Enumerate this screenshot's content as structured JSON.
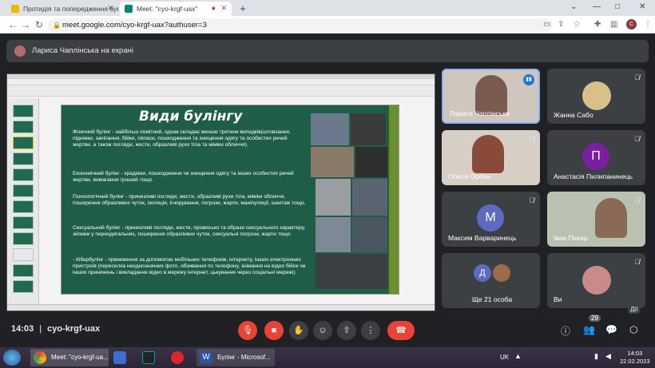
{
  "browser": {
    "tabs": [
      {
        "title": "Протидія та попередження був",
        "active": false
      },
      {
        "title": "Meet: \"cyo-krgf-uax\"",
        "active": true
      }
    ],
    "url": "meet.google.com/cyo-krgf-uax?authuser=3",
    "profile_initial": "C"
  },
  "meet": {
    "presenter_banner": "Лариса Чаплінська на екрані",
    "time": "14:03",
    "meeting_code": "cyo-krgf-uax",
    "participant_count": "29",
    "tiles": [
      {
        "name": "Лариса Чаплінська",
        "type": "video"
      },
      {
        "name": "Жанна Сабо",
        "type": "photo"
      },
      {
        "name": "Олеся Орбан",
        "type": "video"
      },
      {
        "name": "Анастасія Пилипанинець",
        "type": "initial",
        "initial": "П",
        "color": "#7b1fa2"
      },
      {
        "name": "Максим Варваринець",
        "type": "initial",
        "initial": "М",
        "color": "#5c6bc0"
      },
      {
        "name": "Іван Пекар",
        "type": "video"
      },
      {
        "name": "Ще 21 особа",
        "type": "more",
        "initial": "Д",
        "color": "#5c6bc0"
      },
      {
        "name": "Ви",
        "type": "photo"
      }
    ],
    "hover_label": "Дії"
  },
  "slide": {
    "title": "Види булінгу",
    "paragraphs": [
      "Фізичний булінг - найбільш помітний, однак складає менше третини випадків(штовхання, підніжки, зачіпання, бійки, ляпаси, пошкодження та знищення одягу та особистих речей жертви, а також погляди, жести, образливі рухи тіла та міміки обличчя).",
      "Економічний булінг - крадіжки, пошкодження чи знищення одягу та інших особистих речей жертви, вимагання грошей тощо.",
      "Психологічний булінг - принизливі погляди, жести, образливі рухи тіла, міміки обличчя, поширення образливих чуток, ізоляція, ігнорування, погрози, жарти, маніпуляції, шантаж тощо.",
      "Сексуальний булінг - принизливі погляди, жести, прізвисько та образи сексуального характеру, зйомки у переодягальнях, поширення образливих чуток, сексуальні погрози, жарти тощо.",
      "- Кібербулінг - приниження за допомогою мобільних телефонів, інтернету, інших електронних пристроїв (пересилка неоднозначних фото, обзивання по телефону, знімання на відео бійок чи інших принижень і викладання відео в мережу інтернет, цькування через соціальні мережі)."
    ]
  },
  "taskbar": {
    "items": [
      {
        "label": "Meet: \"cyo-krgf-ua...",
        "icon": "chrome-icon"
      },
      {
        "label": "",
        "icon": "save-icon"
      },
      {
        "label": "",
        "icon": "terminal-icon"
      },
      {
        "label": "",
        "icon": "opera-icon"
      },
      {
        "label": "Булінг - Microsof...",
        "icon": "word-icon"
      }
    ],
    "lang": "UK",
    "clock_time": "14:03",
    "clock_date": "22.02.2023"
  }
}
